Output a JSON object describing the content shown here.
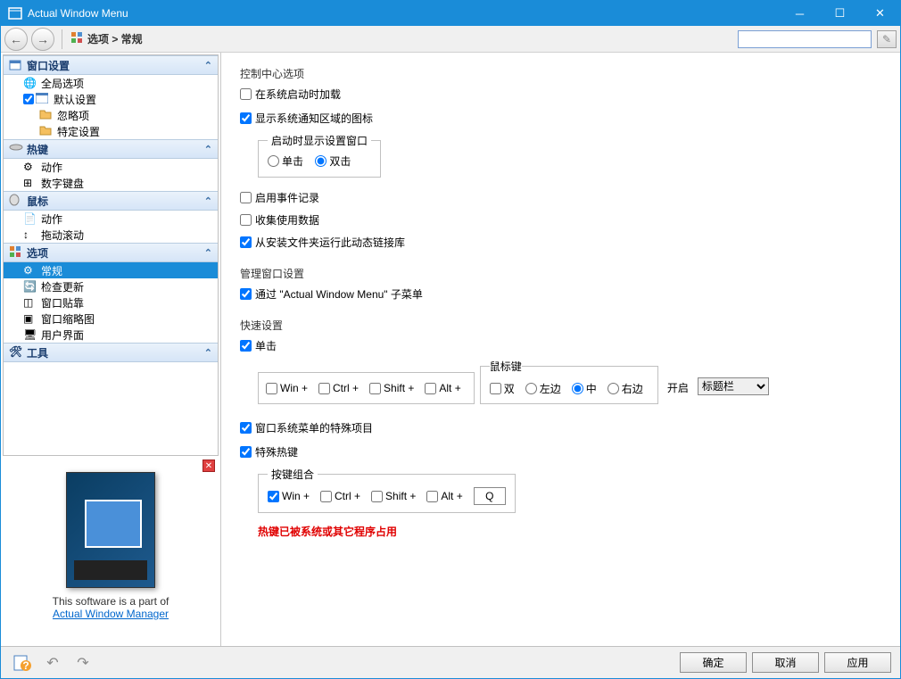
{
  "window": {
    "title": "Actual Window Menu"
  },
  "toolbar": {
    "breadcrumb": "选项 > 常规"
  },
  "sidebar": {
    "sections": [
      {
        "label": "窗口设置",
        "items": [
          {
            "label": "全局选项",
            "checkbox": false,
            "checked": false
          },
          {
            "label": "默认设置",
            "checkbox": true,
            "checked": true
          },
          {
            "label": "忽略项",
            "sub": true
          },
          {
            "label": "特定设置",
            "sub": true
          }
        ]
      },
      {
        "label": "热键",
        "items": [
          {
            "label": "动作"
          },
          {
            "label": "数字键盘"
          }
        ]
      },
      {
        "label": "鼠标",
        "items": [
          {
            "label": "动作"
          },
          {
            "label": "拖动滚动"
          }
        ]
      },
      {
        "label": "选项",
        "items": [
          {
            "label": "常规",
            "selected": true
          },
          {
            "label": "检查更新"
          },
          {
            "label": "窗口贴靠"
          },
          {
            "label": "窗口缩略图"
          },
          {
            "label": "用户界面"
          }
        ]
      },
      {
        "label": "工具",
        "items": []
      }
    ]
  },
  "promo": {
    "box_label": "Actual Window Manager",
    "text": "This software is a part of",
    "link": "Actual Window Manager"
  },
  "content": {
    "control_center": {
      "title": "控制中心选项",
      "load_startup": {
        "label": "在系统启动时加载",
        "checked": false
      },
      "show_tray": {
        "label": "显示系统通知区域的图标",
        "checked": true
      },
      "show_settings_on_launch": {
        "legend": "启动时显示设置窗口",
        "single": "单击",
        "double": "双击",
        "value": "double"
      },
      "enable_log": {
        "label": "启用事件记录",
        "checked": false
      },
      "collect_usage": {
        "label": "收集使用数据",
        "checked": false
      },
      "run_dll": {
        "label": "从安装文件夹运行此动态链接库",
        "checked": true
      }
    },
    "manage_window": {
      "title": "管理窗口设置",
      "via_submenu": {
        "label": "通过 \"Actual Window Menu\" 子菜单",
        "checked": true
      }
    },
    "quick_settings": {
      "title": "快速设置",
      "single_click": {
        "label": "单击",
        "checked": true
      },
      "modifiers": {
        "win": {
          "label": "Win +",
          "checked": false
        },
        "ctrl": {
          "label": "Ctrl +",
          "checked": false
        },
        "shift": {
          "label": "Shift +",
          "checked": false
        },
        "alt": {
          "label": "Alt +",
          "checked": false
        }
      },
      "mouse_group_legend": "鼠标键",
      "mouse_buttons": {
        "double": {
          "label": "双",
          "checked": false
        },
        "left": "左边",
        "middle": "中",
        "right": "右边",
        "value": "middle"
      },
      "open_label": "开启",
      "open_target": "标题栏"
    },
    "sysmenu_special": {
      "label": "窗口系统菜单的特殊项目",
      "checked": true
    },
    "special_hotkey": {
      "label": "特殊热键",
      "checked": true,
      "combo_legend": "按键组合",
      "modifiers": {
        "win": {
          "label": "Win +",
          "checked": true
        },
        "ctrl": {
          "label": "Ctrl +",
          "checked": false
        },
        "shift": {
          "label": "Shift +",
          "checked": false
        },
        "alt": {
          "label": "Alt +",
          "checked": false
        }
      },
      "key": "Q"
    },
    "warning": "热键已被系统或其它程序占用"
  },
  "footer": {
    "ok": "确定",
    "cancel": "取消",
    "apply": "应用"
  }
}
